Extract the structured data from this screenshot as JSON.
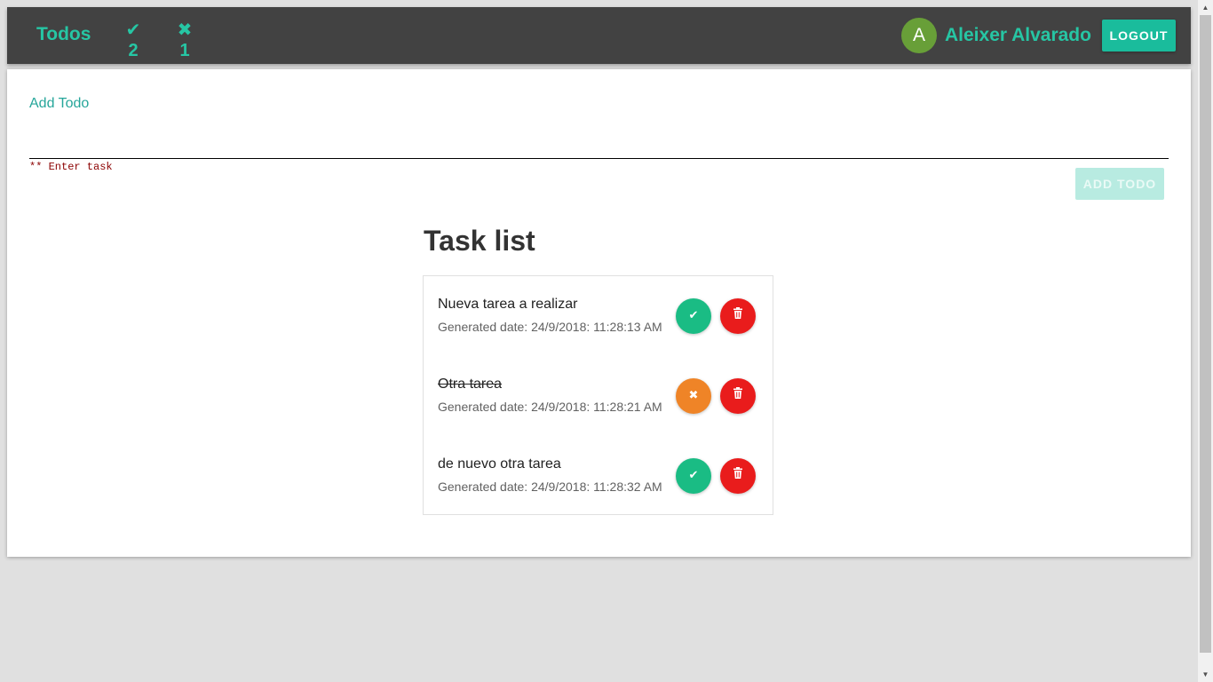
{
  "header": {
    "brand": "Todos",
    "done_icon": "check-icon",
    "done_count": "2",
    "pending_icon": "x-icon",
    "pending_count": "1",
    "avatar_initial": "A",
    "username": "Aleixer Alvarado",
    "logout_label": "LOGOUT"
  },
  "form": {
    "label": "Add Todo",
    "input_value": "",
    "hint": "** Enter task",
    "submit_label": "ADD TODO"
  },
  "task_list": {
    "title": "Task list",
    "tasks": [
      {
        "name": "Nueva tarea a realizar",
        "date": "Generated date: 24/9/2018: 11:28:13 AM",
        "done": false,
        "toggle_icon": "check-icon",
        "delete_icon": "trash-icon"
      },
      {
        "name": "Otra tarea",
        "date": "Generated date: 24/9/2018: 11:28:21 AM",
        "done": true,
        "toggle_icon": "x-icon",
        "delete_icon": "trash-icon"
      },
      {
        "name": "de nuevo otra tarea",
        "date": "Generated date: 24/9/2018: 11:28:32 AM",
        "done": false,
        "toggle_icon": "check-icon",
        "delete_icon": "trash-icon"
      }
    ]
  },
  "colors": {
    "accent": "#26c6a4",
    "appbar": "#424242",
    "avatar": "#689f38",
    "complete_button": "#1abc84",
    "undo_button": "#ef8427",
    "delete_button": "#e91c1c"
  }
}
